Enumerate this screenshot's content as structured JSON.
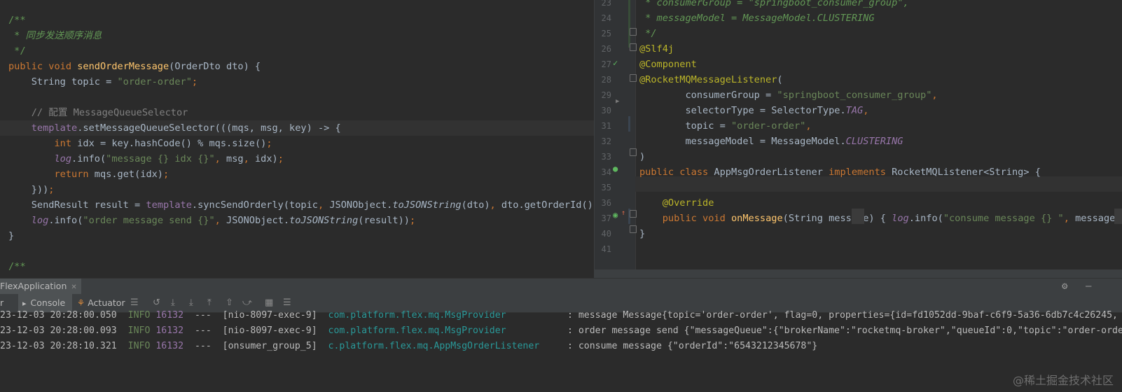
{
  "left_editor": {
    "lines": [
      {
        "tokens": [
          {
            "t": "/**",
            "c": "#629755"
          }
        ]
      },
      {
        "tokens": [
          {
            "t": " * 同步发送顺序消息",
            "c": "#629755",
            "i": 1
          }
        ]
      },
      {
        "tokens": [
          {
            "t": " */",
            "c": "#629755"
          }
        ]
      },
      {
        "tokens": [
          {
            "t": "public void ",
            "c": "#cc7832"
          },
          {
            "t": "sendOrderMessage",
            "c": "#ffc66d"
          },
          {
            "t": "(OrderDto dto) {",
            "c": "#a9b7c6"
          }
        ]
      },
      {
        "tokens": [
          {
            "t": "    String topic = ",
            "c": "#a9b7c6"
          },
          {
            "t": "\"order-order\"",
            "c": "#6a8759"
          },
          {
            "t": ";",
            "c": "#cc7832"
          }
        ]
      },
      {
        "tokens": []
      },
      {
        "tokens": [
          {
            "t": "    // 配置 MessageQueueSelector",
            "c": "#808080"
          }
        ]
      },
      {
        "tokens": [
          {
            "t": "    ",
            "c": "#a9b7c6"
          },
          {
            "t": "template",
            "c": "#9876aa"
          },
          {
            "t": ".setMessageQueueSelector(((mqs, msg, key) -> {",
            "c": "#a9b7c6"
          }
        ]
      },
      {
        "tokens": [
          {
            "t": "        ",
            "c": "#a9b7c6"
          },
          {
            "t": "int ",
            "c": "#cc7832"
          },
          {
            "t": "idx = key.hashCode() % mqs.size()",
            "c": "#a9b7c6"
          },
          {
            "t": ";",
            "c": "#cc7832"
          }
        ]
      },
      {
        "tokens": [
          {
            "t": "        ",
            "c": "#a9b7c6"
          },
          {
            "t": "log",
            "c": "#9876aa",
            "i": 1
          },
          {
            "t": ".info(",
            "c": "#a9b7c6"
          },
          {
            "t": "\"message {} idx {}\"",
            "c": "#6a8759"
          },
          {
            "t": ", ",
            "c": "#cc7832"
          },
          {
            "t": "msg",
            "c": "#a9b7c6"
          },
          {
            "t": ", ",
            "c": "#cc7832"
          },
          {
            "t": "idx)",
            "c": "#a9b7c6"
          },
          {
            "t": ";",
            "c": "#cc7832"
          }
        ]
      },
      {
        "tokens": [
          {
            "t": "        ",
            "c": "#a9b7c6"
          },
          {
            "t": "return ",
            "c": "#cc7832"
          },
          {
            "t": "mqs.get(idx)",
            "c": "#a9b7c6"
          },
          {
            "t": ";",
            "c": "#cc7832"
          }
        ]
      },
      {
        "tokens": [
          {
            "t": "    }))",
            "c": "#a9b7c6"
          },
          {
            "t": ";",
            "c": "#cc7832"
          }
        ]
      },
      {
        "tokens": [
          {
            "t": "    SendResult result = ",
            "c": "#a9b7c6"
          },
          {
            "t": "template",
            "c": "#9876aa"
          },
          {
            "t": ".syncSendOrderly(topic",
            "c": "#a9b7c6"
          },
          {
            "t": ", ",
            "c": "#cc7832"
          },
          {
            "t": "JSONObject.",
            "c": "#a9b7c6"
          },
          {
            "t": "toJSONString",
            "c": "#a9b7c6",
            "i": 1
          },
          {
            "t": "(dto)",
            "c": "#a9b7c6"
          },
          {
            "t": ", ",
            "c": "#cc7832"
          },
          {
            "t": "dto.getOrderId())",
            "c": "#a9b7c6"
          },
          {
            "t": ";",
            "c": "#cc7832"
          }
        ]
      },
      {
        "tokens": [
          {
            "t": "    ",
            "c": "#a9b7c6"
          },
          {
            "t": "log",
            "c": "#9876aa",
            "i": 1
          },
          {
            "t": ".info(",
            "c": "#a9b7c6"
          },
          {
            "t": "\"order message send {}\"",
            "c": "#6a8759"
          },
          {
            "t": ", ",
            "c": "#cc7832"
          },
          {
            "t": "JSONObject.",
            "c": "#a9b7c6"
          },
          {
            "t": "toJSONString",
            "c": "#a9b7c6",
            "i": 1
          },
          {
            "t": "(result))",
            "c": "#a9b7c6"
          },
          {
            "t": ";",
            "c": "#cc7832"
          }
        ]
      },
      {
        "tokens": [
          {
            "t": "}",
            "c": "#a9b7c6"
          }
        ]
      },
      {
        "tokens": []
      },
      {
        "tokens": [
          {
            "t": "/**",
            "c": "#629755"
          }
        ]
      }
    ]
  },
  "right_editor": {
    "line_numbers": [
      "23",
      "24",
      "25",
      "26",
      "27",
      "28",
      "29",
      "30",
      "31",
      "32",
      "33",
      "34",
      "35",
      "36",
      "37",
      "40",
      "41"
    ],
    "lines": [
      {
        "tokens": [
          {
            "t": " * consumerGroup = \"springboot_consumer_group\",",
            "c": "#629755",
            "i": 1
          }
        ]
      },
      {
        "tokens": [
          {
            "t": " * messageModel = MessageModel.CLUSTERING",
            "c": "#629755",
            "i": 1
          }
        ]
      },
      {
        "tokens": [
          {
            "t": " */",
            "c": "#629755",
            "i": 1
          }
        ]
      },
      {
        "tokens": [
          {
            "t": "@Slf4j",
            "c": "#bbb529"
          }
        ]
      },
      {
        "tokens": [
          {
            "t": "@Component",
            "c": "#bbb529"
          }
        ]
      },
      {
        "tokens": [
          {
            "t": "@RocketMQMessageListener",
            "c": "#bbb529"
          },
          {
            "t": "(",
            "c": "#a9b7c6"
          }
        ]
      },
      {
        "tokens": [
          {
            "t": "        consumerGroup = ",
            "c": "#a9b7c6"
          },
          {
            "t": "\"springboot_consumer_group\"",
            "c": "#6a8759"
          },
          {
            "t": ",",
            "c": "#cc7832"
          }
        ]
      },
      {
        "tokens": [
          {
            "t": "        selectorType = SelectorType.",
            "c": "#a9b7c6"
          },
          {
            "t": "TAG",
            "c": "#9876aa",
            "i": 1
          },
          {
            "t": ",",
            "c": "#cc7832"
          }
        ]
      },
      {
        "tokens": [
          {
            "t": "        topic = ",
            "c": "#a9b7c6"
          },
          {
            "t": "\"order-order\"",
            "c": "#6a8759"
          },
          {
            "t": ",",
            "c": "#cc7832"
          }
        ]
      },
      {
        "tokens": [
          {
            "t": "        messageModel = MessageModel.",
            "c": "#a9b7c6"
          },
          {
            "t": "CLUSTERING",
            "c": "#9876aa",
            "i": 1
          }
        ]
      },
      {
        "tokens": [
          {
            "t": ")",
            "c": "#a9b7c6"
          }
        ]
      },
      {
        "tokens": [
          {
            "t": "public class ",
            "c": "#cc7832"
          },
          {
            "t": "AppMsgOrderListener ",
            "c": "#a9b7c6"
          },
          {
            "t": "implements ",
            "c": "#cc7832"
          },
          {
            "t": "RocketMQListener<String> {",
            "c": "#a9b7c6"
          }
        ]
      },
      {
        "tokens": []
      },
      {
        "tokens": [
          {
            "t": "    @Override",
            "c": "#bbb529"
          }
        ]
      },
      {
        "tokens": [
          {
            "t": "    ",
            "c": "#a9b7c6"
          },
          {
            "t": "public void ",
            "c": "#cc7832"
          },
          {
            "t": "onMessage",
            "c": "#ffc66d"
          },
          {
            "t": "(String message) { ",
            "c": "#a9b7c6"
          },
          {
            "t": "log",
            "c": "#9876aa",
            "i": 1
          },
          {
            "t": ".info(",
            "c": "#a9b7c6"
          },
          {
            "t": "\"consume message {} \"",
            "c": "#6a8759"
          },
          {
            "t": ", ",
            "c": "#cc7832"
          },
          {
            "t": "message)",
            "c": "#a9b7c6"
          },
          {
            "t": "; ",
            "c": "#cc7832"
          },
          {
            "t": "}",
            "c": "#a9b7c6"
          }
        ]
      },
      {
        "tokens": [
          {
            "t": "}",
            "c": "#a9b7c6"
          }
        ]
      },
      {
        "tokens": []
      }
    ]
  },
  "run_panel": {
    "run_tab_label": "FlexApplication",
    "toolbar": {
      "left_label": "r",
      "console_label": "Console",
      "actuator_label": "Actuator"
    },
    "logs": [
      {
        "ts": "23-12-03 20:28:00.050",
        "level": "INFO",
        "pid": "16132",
        "sep": "---",
        "thread": "[nio-8097-exec-9]",
        "logger": "com.platform.flex.mq.MsgProvider          ",
        "msg": " : message Message{topic='order-order', flag=0, properties={id=fd1052dd-9baf-c6f9-5a36-6db7c4c26245, WAI"
      },
      {
        "ts": "23-12-03 20:28:00.093",
        "level": "INFO",
        "pid": "16132",
        "sep": "---",
        "thread": "[nio-8097-exec-9]",
        "logger": "com.platform.flex.mq.MsgProvider          ",
        "msg": " : order message send {\"messageQueue\":{\"brokerName\":\"rocketmq-broker\",\"queueId\":0,\"topic\":\"order-order\"}"
      },
      {
        "ts": "23-12-03 20:28:10.321",
        "level": "INFO",
        "pid": "16132",
        "sep": "---",
        "thread": "[onsumer_group_5]",
        "logger": "c.platform.flex.mq.AppMsgOrderListener    ",
        "msg": " : consume message {\"orderId\":\"6543212345678\"}"
      }
    ]
  },
  "watermark": "@稀土掘金技术社区",
  "colors": {
    "keyword": "#cc7832",
    "string": "#6a8759",
    "doc": "#629755",
    "annotation": "#bbb529",
    "method": "#ffc66d",
    "field": "#9876aa",
    "info": "#6a8759",
    "pid": "#9876aa",
    "logger": "#299999"
  }
}
